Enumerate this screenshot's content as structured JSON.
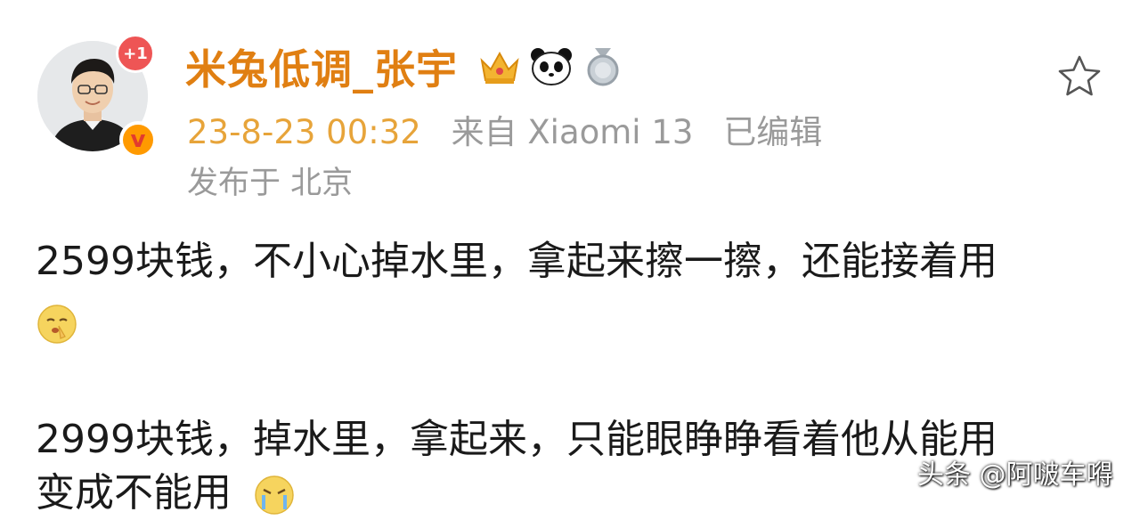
{
  "post": {
    "author": {
      "name": "米兔低调_张宇",
      "avatar_badge": "+1",
      "verified_badge": "v"
    },
    "meta": {
      "time": "23-8-23 00:32",
      "source": "来自 Xiaomi 13",
      "edited": "已编辑",
      "location": "发布于 北京"
    },
    "content": {
      "line1": "2599块钱，不小心掉水里，拿起来擦一擦，还能接着用",
      "line2": "2999块钱，掉水里，拿起来，只能眼睁睁看着他从能用",
      "line3": "变成不能用"
    }
  },
  "watermark": "头条 @阿啵车嘚",
  "icons": {
    "crown": "crown-icon",
    "panda": "panda-icon",
    "medal": "medal-icon",
    "star": "star-icon",
    "emoji_shush": "shush-emoji-icon",
    "emoji_cry": "crying-emoji-icon"
  },
  "colors": {
    "username": "#e07f12",
    "time": "#e7a43a",
    "device": "#3a6f9c",
    "meta": "#9a9a9a",
    "badge_red": "#ee5555",
    "badge_orange": "#ff9a00"
  }
}
